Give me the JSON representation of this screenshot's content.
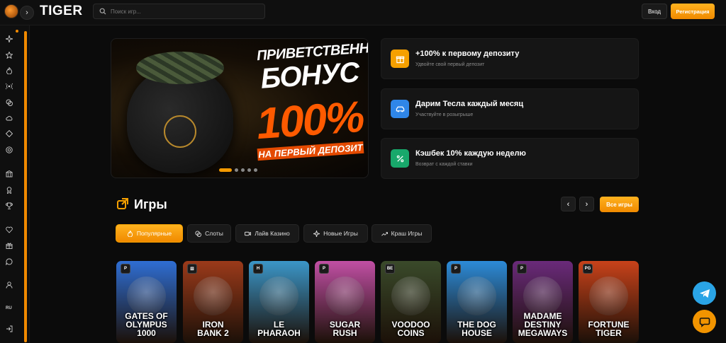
{
  "header": {
    "brand": "TIGER",
    "nav_toggle": "›",
    "search_placeholder": "Поиск игр...",
    "login_label": "Вход",
    "register_label": "Регистрация"
  },
  "sidebar": {
    "lang": "RU",
    "icons": [
      "sparkle-icon",
      "star-icon",
      "fire-icon",
      "live-icon",
      "coins-icon",
      "cloud-icon",
      "diamond-icon",
      "chip-icon",
      "casino-icon",
      "award-icon",
      "trophy-icon",
      "heart-icon",
      "gift-icon",
      "chat-icon",
      "user-icon",
      "login-icon"
    ]
  },
  "banner": {
    "line1": "ПРИВЕТСТВЕННЫЙ",
    "line2": "БОНУС",
    "line3": "100%",
    "line4": "НА ПЕРВЫЙ ДЕПОЗИТ",
    "slides": 5,
    "active_slide": 1
  },
  "promos": [
    {
      "title": "+100% к первому депозиту",
      "subtitle": "Удвойте свой первый депозит",
      "icon": "gift-icon",
      "color": "#f5a000"
    },
    {
      "title": "Дарим Тесла каждый месяц",
      "subtitle": "Участвуйте в розыгрыше",
      "icon": "car-icon",
      "color": "#2f86e8"
    },
    {
      "title": "Кэшбек 10% каждую неделю",
      "subtitle": "Возврат с каждой ставки",
      "icon": "percent-icon",
      "color": "#18a86b"
    }
  ],
  "games": {
    "title": "Игры",
    "prev": "‹",
    "next": "›",
    "all_label": "Все игры",
    "tabs": [
      {
        "label": "Популярные",
        "icon": "fire-icon",
        "active": true
      },
      {
        "label": "Слоты",
        "icon": "coins-icon",
        "active": false
      },
      {
        "label": "Лайв Казино",
        "icon": "video-icon",
        "active": false
      },
      {
        "label": "Новые Игры",
        "icon": "sparkle-icon",
        "active": false
      },
      {
        "label": "Краш Игры",
        "icon": "trend-icon",
        "active": false
      }
    ],
    "cards": [
      {
        "line1": "GATES OF",
        "line2": "OLYMPUS",
        "line3": "1000",
        "provider": "P",
        "bg": "#2f6ed3"
      },
      {
        "line1": "IRON",
        "line2": "BANK 2",
        "line3": "",
        "provider": "⚄",
        "bg": "#9b3a1a"
      },
      {
        "line1": "LE",
        "line2": "PHARAOH",
        "line3": "",
        "provider": "H",
        "bg": "#3b96c8"
      },
      {
        "line1": "SUGAR",
        "line2": "RUSH",
        "line3": "",
        "provider": "P",
        "bg": "#c14fa4"
      },
      {
        "line1": "VOODOO",
        "line2": "COINS",
        "line3": "",
        "provider": "BE",
        "bg": "#3a4a2a"
      },
      {
        "line1": "THE DOG",
        "line2": "HOUSE",
        "line3": "",
        "provider": "P",
        "bg": "#2c8bd8"
      },
      {
        "line1": "MADAME",
        "line2": "DESTINY",
        "line3": "MEGAWAYS",
        "provider": "P",
        "bg": "#6a2a7a"
      },
      {
        "line1": "FORTUNE",
        "line2": "TIGER",
        "line3": "",
        "provider": "PG",
        "bg": "#c8421a"
      }
    ]
  }
}
